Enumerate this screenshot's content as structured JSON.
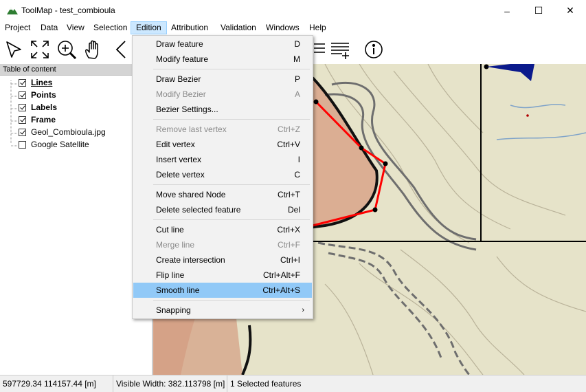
{
  "window": {
    "title": "ToolMap - test_combioula",
    "minimize": "–",
    "maximize": "☐",
    "close": "✕"
  },
  "menubar": [
    "Project",
    "Data",
    "View",
    "Selection",
    "Edition",
    "Attribution",
    "Validation",
    "Windows",
    "Help"
  ],
  "toc": {
    "header": "Table of content",
    "layers": [
      {
        "label": "Lines",
        "checked": true,
        "bold": true
      },
      {
        "label": "Points",
        "checked": true,
        "bold": true
      },
      {
        "label": "Labels",
        "checked": true,
        "bold": true
      },
      {
        "label": "Frame",
        "checked": true,
        "bold": true
      },
      {
        "label": "Geol_Combioula.jpg",
        "checked": true,
        "bold": false
      },
      {
        "label": "Google Satellite",
        "checked": false,
        "bold": false
      }
    ]
  },
  "edition_menu": {
    "groups": [
      [
        {
          "label": "Draw feature",
          "shortcut": "D",
          "disabled": false
        },
        {
          "label": "Modify feature",
          "shortcut": "M",
          "disabled": false
        }
      ],
      [
        {
          "label": "Draw Bezier",
          "shortcut": "P",
          "disabled": false
        },
        {
          "label": "Modify Bezier",
          "shortcut": "A",
          "disabled": true
        },
        {
          "label": "Bezier Settings...",
          "shortcut": "",
          "disabled": false
        }
      ],
      [
        {
          "label": "Remove last vertex",
          "shortcut": "Ctrl+Z",
          "disabled": true
        },
        {
          "label": "Edit vertex",
          "shortcut": "Ctrl+V",
          "disabled": false
        },
        {
          "label": "Insert vertex",
          "shortcut": "I",
          "disabled": false
        },
        {
          "label": "Delete vertex",
          "shortcut": "C",
          "disabled": false
        }
      ],
      [
        {
          "label": "Move shared Node",
          "shortcut": "Ctrl+T",
          "disabled": false
        },
        {
          "label": "Delete selected feature",
          "shortcut": "Del",
          "disabled": false
        }
      ],
      [
        {
          "label": "Cut line",
          "shortcut": "Ctrl+X",
          "disabled": false
        },
        {
          "label": "Merge line",
          "shortcut": "Ctrl+F",
          "disabled": true
        },
        {
          "label": "Create intersection",
          "shortcut": "Ctrl+I",
          "disabled": false
        },
        {
          "label": "Flip line",
          "shortcut": "Ctrl+Alt+F",
          "disabled": false
        },
        {
          "label": "Smooth line",
          "shortcut": "Ctrl+Alt+S",
          "disabled": false,
          "hover": true
        }
      ],
      [
        {
          "label": "Snapping",
          "shortcut": "",
          "disabled": false,
          "submenu": true
        }
      ]
    ]
  },
  "status": {
    "coords": "597729.34 114157.44 [m]",
    "width": "Visible Width: 382.113798 [m]",
    "selected": "1 Selected features"
  },
  "colors": {
    "selection_line": "#ff0000",
    "menu_hover": "#91c9f7",
    "menu_active": "#cce8ff"
  }
}
